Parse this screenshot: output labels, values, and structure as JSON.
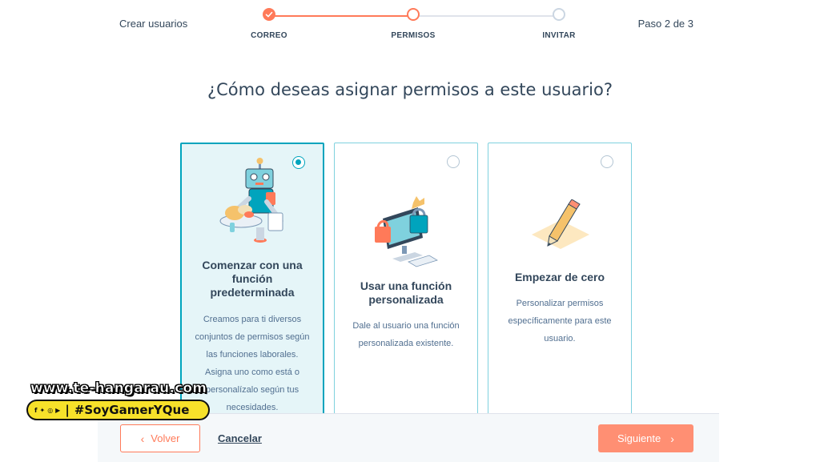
{
  "header": {
    "title": "Crear usuarios",
    "step_counter": "Paso 2 de 3",
    "steps": [
      {
        "label": "CORREO",
        "state": "done"
      },
      {
        "label": "PERMISOS",
        "state": "current"
      },
      {
        "label": "INVITAR",
        "state": "pending"
      }
    ]
  },
  "question": "¿Cómo deseas asignar permisos a este usuario?",
  "cards": [
    {
      "title": "Comenzar con una función predeterminada",
      "description": "Creamos para ti diversos conjuntos de permisos según las funciones laborales. Asigna uno como está o personalízalo según tus necesidades.",
      "selected": true,
      "icon": "robot-waiter-icon"
    },
    {
      "title": "Usar una función personalizada",
      "description": "Dale al usuario una función personalizada existente.",
      "selected": false,
      "icon": "computer-lock-icon"
    },
    {
      "title": "Empezar de cero",
      "description": "Personalizar permisos específicamente para este usuario.",
      "selected": false,
      "icon": "pencil-icon"
    }
  ],
  "footer": {
    "back_label": "Volver",
    "cancel_label": "Cancelar",
    "next_label": "Siguiente"
  },
  "watermark": {
    "url": "www.te-hangarau.com",
    "hashtag": "#SoyGamerYQue",
    "social_icons": [
      "facebook-icon",
      "twitter-icon",
      "instagram-icon",
      "youtube-icon"
    ]
  },
  "colors": {
    "accent": "#ff7a59",
    "accent_light": "#ff8f73",
    "teal": "#00a4bd",
    "text": "#33475b",
    "selected_bg": "#e5f5f8"
  }
}
